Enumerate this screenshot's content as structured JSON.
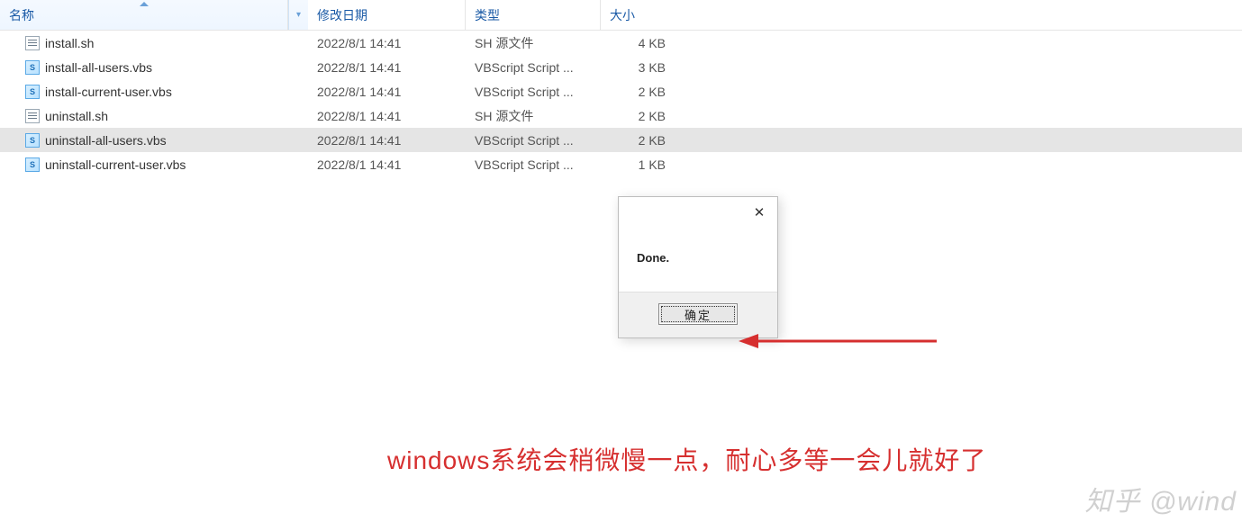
{
  "columns": {
    "name": "名称",
    "date": "修改日期",
    "type": "类型",
    "size": "大小"
  },
  "files": [
    {
      "icon": "sh",
      "name": "install.sh",
      "date": "2022/8/1 14:41",
      "type": "SH 源文件",
      "size": "4 KB",
      "selected": false
    },
    {
      "icon": "vbs",
      "name": "install-all-users.vbs",
      "date": "2022/8/1 14:41",
      "type": "VBScript Script ...",
      "size": "3 KB",
      "selected": false
    },
    {
      "icon": "vbs",
      "name": "install-current-user.vbs",
      "date": "2022/8/1 14:41",
      "type": "VBScript Script ...",
      "size": "2 KB",
      "selected": false
    },
    {
      "icon": "sh",
      "name": "uninstall.sh",
      "date": "2022/8/1 14:41",
      "type": "SH 源文件",
      "size": "2 KB",
      "selected": false
    },
    {
      "icon": "vbs",
      "name": "uninstall-all-users.vbs",
      "date": "2022/8/1 14:41",
      "type": "VBScript Script ...",
      "size": "2 KB",
      "selected": true
    },
    {
      "icon": "vbs",
      "name": "uninstall-current-user.vbs",
      "date": "2022/8/1 14:41",
      "type": "VBScript Script ...",
      "size": "1 KB",
      "selected": false
    }
  ],
  "dialog": {
    "message": "Done.",
    "ok_label": "确定"
  },
  "caption": "windows系统会稍微慢一点，耐心多等一会儿就好了",
  "watermark": "知乎 @wind"
}
